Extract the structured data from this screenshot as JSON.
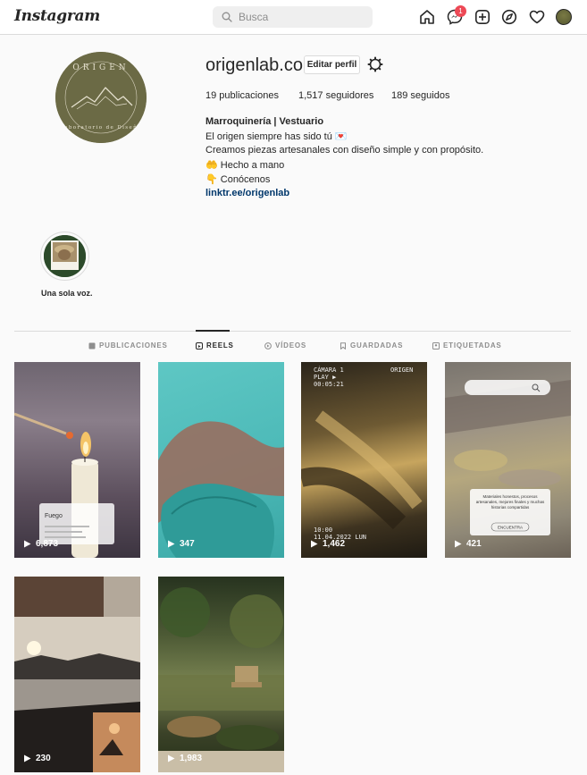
{
  "topbar": {
    "logo": "Instagram",
    "search_placeholder": "Busca",
    "notification_count": "1",
    "icons": [
      "home-icon",
      "messenger-icon",
      "new-post-icon",
      "explore-icon",
      "activity-heart-icon",
      "profile-avatar"
    ]
  },
  "profile": {
    "username": "origenlab.co",
    "edit_label": "Editar perfil",
    "stats": {
      "posts": "19 publicaciones",
      "followers": "1,517 seguidores",
      "following": "189 seguidos"
    },
    "bio": {
      "name": "Marroquinería | Vestuario",
      "lines": [
        "El origen siempre has sido tú 💌",
        "Creamos piezas artesanales con diseño simple y con propósito.",
        "🤲 Hecho a mano",
        "👇 Conócenos"
      ],
      "link": "linktr.ee/origenlab"
    },
    "logo_text": "ORIGEN",
    "logo_subtext": "Laboratorio de Diseño"
  },
  "highlight": {
    "label": "Una sola voz."
  },
  "tabs": [
    {
      "label": "PUBLICACIONES",
      "icon": "grid-icon"
    },
    {
      "label": "REELS",
      "icon": "reels-icon"
    },
    {
      "label": "VÍDEOS",
      "icon": "video-icon"
    },
    {
      "label": "GUARDADAS",
      "icon": "bookmark-icon"
    },
    {
      "label": "ETIQUETADAS",
      "icon": "tag-icon"
    }
  ],
  "active_tab": "REELS",
  "reels": [
    {
      "views": "6,873",
      "overlay_title": "Fuego"
    },
    {
      "views": "347"
    },
    {
      "views": "1,462",
      "overlay_top_left": "CÁMARA 1",
      "overlay_top_left_2": "PLAY ▶",
      "overlay_top_left_3": "00:05:21",
      "overlay_top_right": "ORIGEN",
      "overlay_bottom": "10:00",
      "overlay_bottom_2": "11.04.2022 LUN"
    },
    {
      "views": "421",
      "overlay_text": "Materiales honestos, procesos artesanales, mejores finales y muchas historias compartidas",
      "overlay_button": "ENCUENTRA"
    },
    {
      "views": "230"
    },
    {
      "views": "1,983"
    }
  ]
}
